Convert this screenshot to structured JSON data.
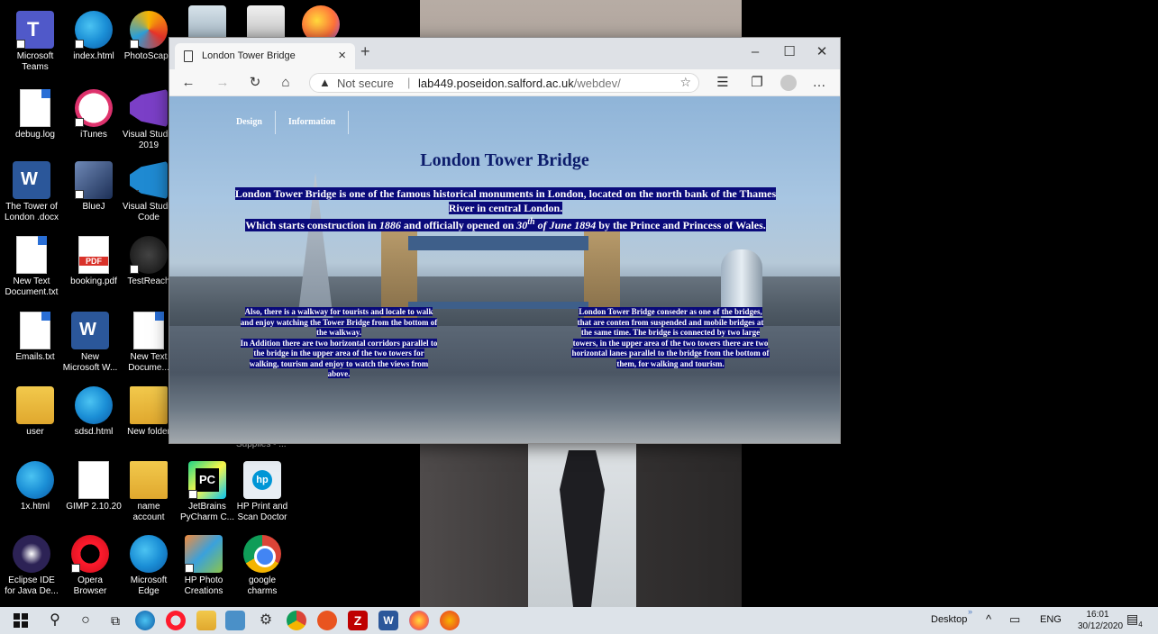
{
  "desktop": {
    "icons": [
      {
        "label": "Microsoft Teams",
        "icon": "teams-icon"
      },
      {
        "label": "index.html",
        "icon": "edge-icon"
      },
      {
        "label": "PhotoScape",
        "icon": "photoscape-icon"
      },
      {
        "label": "debug.log",
        "icon": "document-icon"
      },
      {
        "label": "iTunes",
        "icon": "itunes-icon"
      },
      {
        "label": "Visual Studio 2019",
        "icon": "visual-studio-icon"
      },
      {
        "label": "The Tower of London .docx",
        "icon": "word-icon"
      },
      {
        "label": "BlueJ",
        "icon": "bluej-icon"
      },
      {
        "label": "Visual Studio Code",
        "icon": "vscode-icon"
      },
      {
        "label": "New Text Document.txt",
        "icon": "document-icon"
      },
      {
        "label": "booking.pdf",
        "icon": "pdf-icon"
      },
      {
        "label": "TestReach",
        "icon": "testreach-icon"
      },
      {
        "label": "Emails.txt",
        "icon": "document-icon"
      },
      {
        "label": "New Microsoft W...",
        "icon": "word-icon"
      },
      {
        "label": "New Text Docume...",
        "icon": "document-icon"
      },
      {
        "label": "user",
        "icon": "user-folder-icon"
      },
      {
        "label": "sdsd.html",
        "icon": "edge-icon"
      },
      {
        "label": "New folder",
        "icon": "folder-icon"
      },
      {
        "label": "1x.html",
        "icon": "edge-icon"
      },
      {
        "label": "GIMP 2.10.20",
        "icon": "gimp-icon"
      },
      {
        "label": "name account",
        "icon": "folder-icon"
      },
      {
        "label": "JetBrains PyCharm C...",
        "icon": "pycharm-icon"
      },
      {
        "label": "HP Print and Scan Doctor",
        "icon": "hp-icon"
      },
      {
        "label": "Eclipse IDE for Java De...",
        "icon": "eclipse-icon"
      },
      {
        "label": "Opera Browser",
        "icon": "opera-icon"
      },
      {
        "label": "Microsoft Edge",
        "icon": "edge-icon"
      },
      {
        "label": "HP Photo Creations",
        "icon": "hp-photo-icon"
      },
      {
        "label": "google charms",
        "icon": "chrome-icon"
      }
    ],
    "partial_label": "Supplies - ..."
  },
  "browser": {
    "tab_title": "London Tower Bridge",
    "security_label": "Not secure",
    "url_host": "lab449.poseidon.salford.ac.uk",
    "url_path": "/webdev/",
    "icons": {
      "back": "back-arrow-icon",
      "forward": "forward-arrow-icon",
      "refresh": "refresh-icon",
      "home": "home-icon",
      "warning": "warning-icon",
      "favorite": "star-icon",
      "favorites": "favorites-icon",
      "collections": "collections-icon",
      "profile": "profile-icon",
      "more": "more-icon",
      "minimize": "minimize-icon",
      "maximize": "maximize-icon",
      "close": "close-icon"
    }
  },
  "page": {
    "nav": [
      "Design",
      "Information"
    ],
    "heading": "London Tower Bridge",
    "intro_line1": "London Tower Bridge is one of the famous historical monuments in London, located on the north bank of the Thames River in central London.",
    "intro_line2_a": "Which starts construction in ",
    "intro_year": "1886",
    "intro_line2_b": " and officially opened on ",
    "intro_day": "30",
    "intro_sup": "th",
    "intro_date_rest": " of June 1894",
    "intro_line2_c": " by the Prince and Princess of Wales.",
    "left_text_1": "Also, there is a walkway for tourists and locale to walk and enjoy watching the Tower Bridge from the bottom of the walkway.",
    "left_text_2": "In Addition there are two horizontal corridors parallel to the bridge in the upper area of the two towers for walking, tourism and enjoy to watch the views from above.",
    "right_text": "London Tower Bridge conseder as one of the bridges, that are conten from suspended and mobile bridges at the same time. The bridge is connected by two large towers, in the upper area of the two towers there are two horizontal lanes parallel to the bridge from the bottom of them, for walking and tourism."
  },
  "taskbar": {
    "items": [
      "start-icon",
      "search-icon",
      "cortana-icon",
      "task-view-icon",
      "edge-icon",
      "opera-icon",
      "file-explorer-icon",
      "photo-icon",
      "settings-icon",
      "chrome-icon",
      "ubuntu-icon",
      "filezilla-icon",
      "word-icon",
      "firefox-icon",
      "paint-icon"
    ],
    "desktop_label": "Desktop",
    "language": "ENG",
    "time": "16:01",
    "date": "30/12/2020",
    "notification_count": "4"
  },
  "colors": {
    "taskbar": "#dde3e9",
    "heading": "#0c1c6b",
    "text_highlight": "#0a0a7a"
  }
}
